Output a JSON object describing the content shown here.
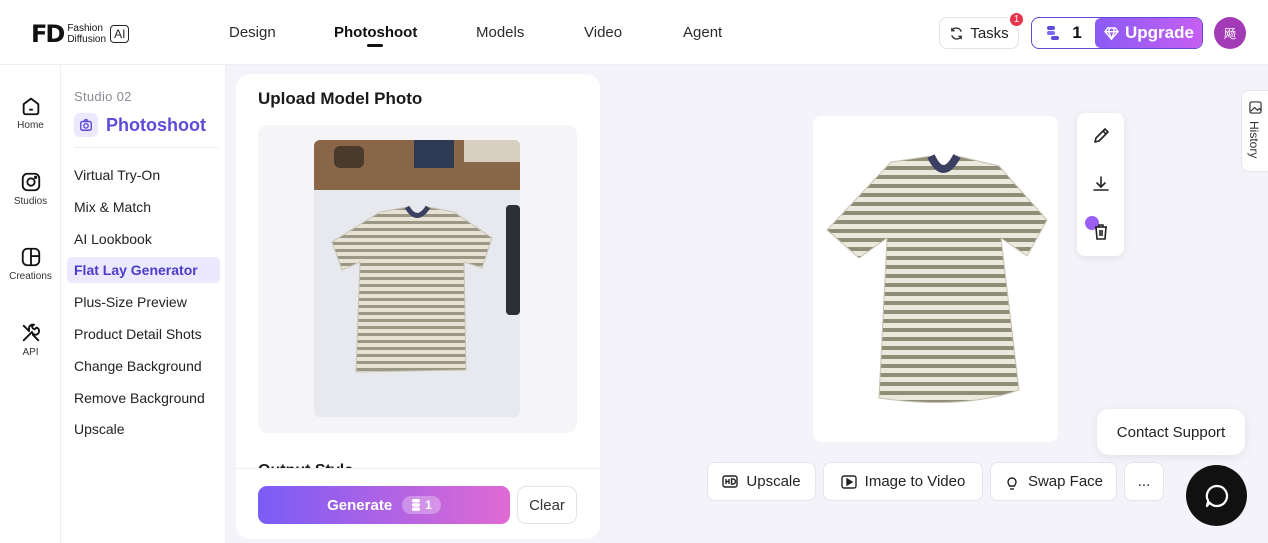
{
  "brand": {
    "mark": "FD",
    "line1": "Fashion",
    "line2": "Diffusion",
    "ai": "AI"
  },
  "nav": [
    {
      "label": "Design"
    },
    {
      "label": "Photoshoot",
      "active": true
    },
    {
      "label": "Models"
    },
    {
      "label": "Video"
    },
    {
      "label": "Agent"
    }
  ],
  "header": {
    "tasks_label": "Tasks",
    "tasks_badge": "1",
    "credits": "1",
    "upgrade_label": "Upgrade",
    "avatar_initial": "飏"
  },
  "rail": [
    {
      "label": "Home",
      "icon": "home-icon"
    },
    {
      "label": "Studios",
      "icon": "camera-icon"
    },
    {
      "label": "Creations",
      "icon": "grid-icon"
    },
    {
      "label": "API",
      "icon": "tools-icon"
    }
  ],
  "subnav": {
    "studio_label": "Studio 02",
    "title": "Photoshoot",
    "items": [
      {
        "label": "Virtual Try-On"
      },
      {
        "label": "Mix & Match"
      },
      {
        "label": "AI Lookbook"
      },
      {
        "label": "Flat Lay Generator",
        "active": true
      },
      {
        "label": "Plus-Size Preview"
      },
      {
        "label": "Product Detail Shots"
      },
      {
        "label": "Change Background"
      },
      {
        "label": "Remove Background"
      },
      {
        "label": "Upscale"
      }
    ]
  },
  "panel": {
    "title": "Upload Model Photo",
    "next_section": "Output Style",
    "generate_label": "Generate",
    "generate_cost": "1",
    "clear_label": "Clear"
  },
  "result": {
    "history_label": "History",
    "actions": [
      {
        "label": "Upscale",
        "icon": "hd-icon"
      },
      {
        "label": "Image to Video",
        "icon": "play-icon"
      },
      {
        "label": "Swap Face",
        "icon": "face-icon"
      },
      {
        "label": "...",
        "icon": "more-icon"
      }
    ],
    "support_label": "Contact Support"
  },
  "colors": {
    "accent": "#5d4bd9",
    "upgrade_start": "#8a5bf5",
    "upgrade_end": "#c75ff2",
    "badge": "#e8344b"
  }
}
